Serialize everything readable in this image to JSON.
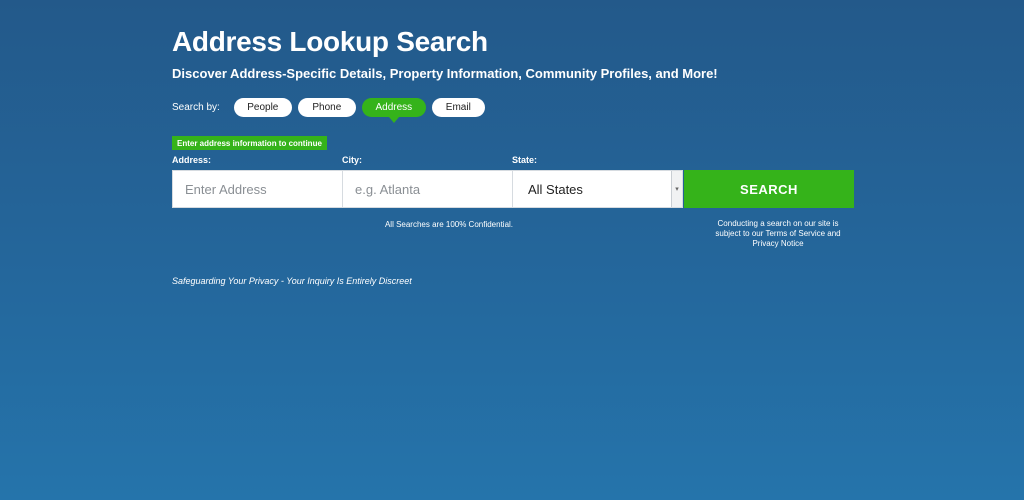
{
  "page": {
    "title": "Address Lookup Search",
    "subtitle": "Discover Address-Specific Details, Property Information, Community Profiles, and More!"
  },
  "search_by": {
    "label": "Search by:",
    "options": [
      "People",
      "Phone",
      "Address",
      "Email"
    ],
    "selected": "Address"
  },
  "notice": "Enter address information to continue",
  "form": {
    "address_label": "Address:",
    "address_placeholder": "Enter Address",
    "city_label": "City:",
    "city_placeholder": "e.g. Atlanta",
    "state_label": "State:",
    "state_value": "All States",
    "search_button": "SEARCH"
  },
  "confidential_note": "All Searches are 100% Confidential.",
  "terms_note": [
    "Conducting a search on our site is",
    "subject to our Terms of Service and",
    "Privacy Notice"
  ],
  "privacy_note": "Safeguarding Your Privacy - Your Inquiry Is Entirely Discreet",
  "colors": {
    "accent_green": "#35b31a",
    "background_top": "#23598a",
    "background_bottom": "#2574ab"
  }
}
